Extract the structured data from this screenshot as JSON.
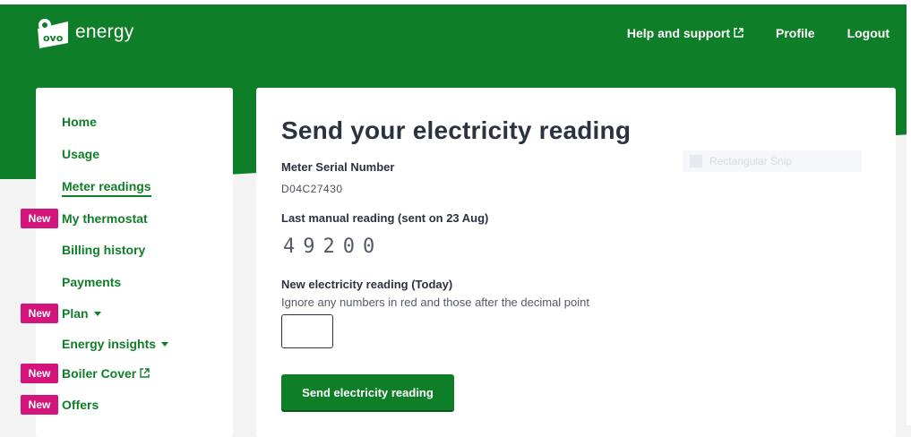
{
  "brand": {
    "name": "energy",
    "primary": "#0f7e28",
    "accent": "#d3157b"
  },
  "topnav": {
    "help": "Help and support",
    "profile": "Profile",
    "logout": "Logout"
  },
  "sidebar": {
    "items": [
      {
        "label": "Home"
      },
      {
        "label": "Usage"
      },
      {
        "label": "Meter readings"
      },
      {
        "label": "My thermostat",
        "badge": "New"
      },
      {
        "label": "Billing history"
      },
      {
        "label": "Payments"
      },
      {
        "label": "Plan",
        "badge": "New"
      },
      {
        "label": "Energy insights"
      },
      {
        "label": "Boiler Cover",
        "badge": "New"
      },
      {
        "label": "Offers",
        "badge": "New"
      }
    ]
  },
  "main": {
    "title": "Send your electricity reading",
    "meter_serial_label": "Meter Serial Number",
    "meter_serial_value": "D04C27430",
    "last_reading_label": "Last manual reading (sent on 23 Aug)",
    "last_reading_value": "49200",
    "new_reading_label": "New electricity reading (Today)",
    "new_reading_hint": "Ignore any numbers in red and those after the decimal point",
    "input_value": "",
    "submit_label": "Send electricity reading",
    "ghost_text": "Rectangular Snip"
  }
}
